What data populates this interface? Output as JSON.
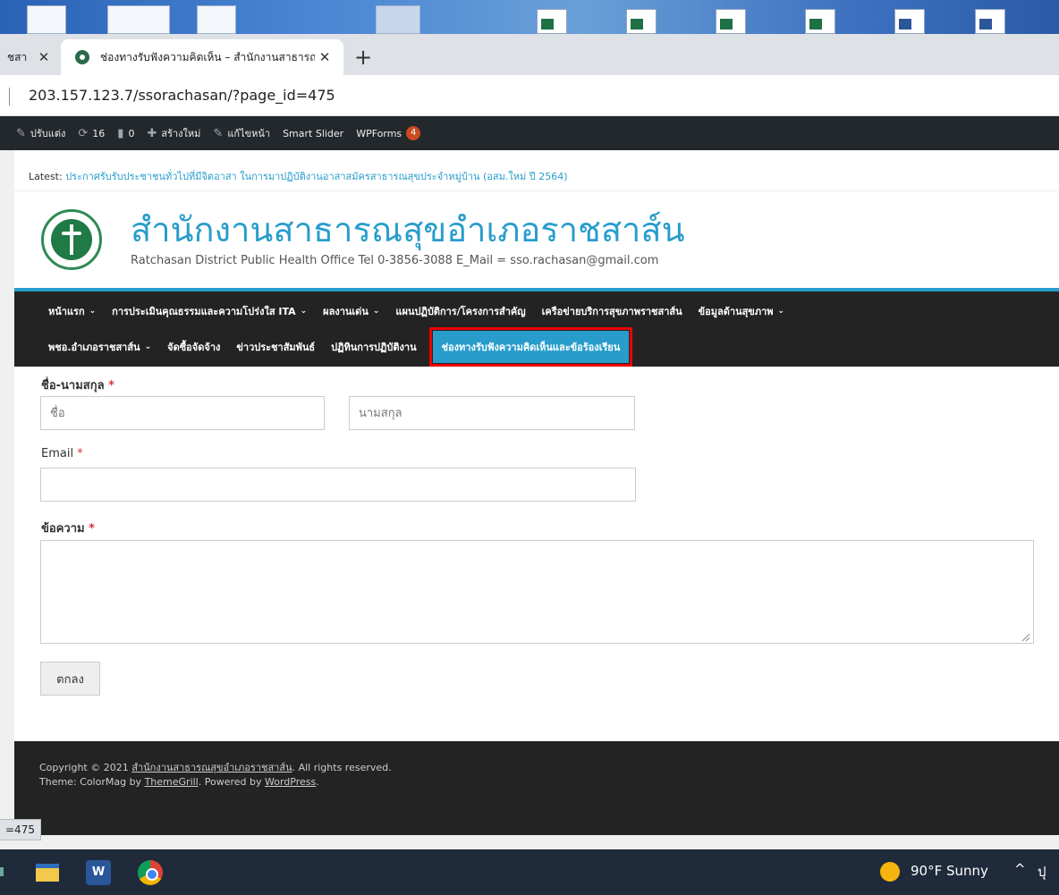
{
  "browser": {
    "tabs": [
      {
        "label": "ชสา"
      },
      {
        "label": "ช่องทางรับฟังความคิดเห็น – สำนักงานสาธารณสุขอำเภอราชสาส์น"
      }
    ],
    "close_glyph": "✕",
    "new_tab_glyph": "+",
    "url": "203.157.123.7/ssorachasan/?page_id=475",
    "status_url": "=475"
  },
  "adminbar": {
    "customize": "ปรับแต่ง",
    "updates_count": "16",
    "comments_count": "0",
    "new": "สร้างใหม่",
    "edit_page": "แก้ไขหน้า",
    "smart_slider": "Smart Slider",
    "wpforms": "WPForms",
    "wpforms_badge": "4"
  },
  "site": {
    "latest_label": "Latest:",
    "latest_link": "ประกาศรับรับประชาชนทั่วไปที่มีจิตอาสา ในการมาปฏิบัติงานอาสาสมัครสาธารณสุขประจำหมู่บ้าน (อสม.ใหม่ ปี 2564)",
    "title": "สำนักงานสาธารณสุขอำเภอราชสาส์น",
    "description": "Ratchasan District Public Health Office Tel 0-3856-3088 E_Mail = sso.rachasan@gmail.com"
  },
  "nav": {
    "row1": [
      {
        "label": "หน้าแรก",
        "dropdown": true
      },
      {
        "label": "การประเมินคุณธรรมและความโปร่งใส ITA",
        "dropdown": true
      },
      {
        "label": "ผลงานเด่น",
        "dropdown": true
      },
      {
        "label": "แผนปฏิบัติการ/โครงการสำคัญ",
        "dropdown": false
      },
      {
        "label": "เครือข่ายบริการสุขภาพราชสาส์น",
        "dropdown": false
      },
      {
        "label": "ข้อมูลด้านสุขภาพ",
        "dropdown": true
      }
    ],
    "row2": [
      {
        "label": "พชอ.อำเภอราชสาส์น",
        "dropdown": true
      },
      {
        "label": "จัดซื้อจัดจ้าง",
        "dropdown": false
      },
      {
        "label": "ข่าวประชาสัมพันธ์",
        "dropdown": false
      },
      {
        "label": "ปฏิทินการปฏิบัติงาน",
        "dropdown": false
      },
      {
        "label": "ช่องทางรับฟังความคิดเห็นและข้อร้องเรียน",
        "dropdown": false,
        "active": true
      }
    ],
    "chevron": "⌄"
  },
  "form": {
    "name_label": "ชื่อ-นามสกุล",
    "required_mark": "*",
    "first_placeholder": "ชื่อ",
    "last_placeholder": "นามสกุล",
    "email_label": "Email",
    "message_label": "ข้อความ",
    "submit_label": "ตกลง"
  },
  "footer": {
    "copyright_prefix": "Copyright © 2021",
    "site_link": "สำนักงานสาธารณสุขอำเภอราชสาส์น",
    "copyright_suffix": ". All rights reserved.",
    "theme_prefix": "Theme: ColorMag by",
    "theme_author": "ThemeGrill",
    "powered_prefix": ". Powered by",
    "powered_link": "WordPress",
    "powered_suffix": "."
  },
  "taskbar": {
    "word_glyph": "W",
    "weather": "90°F  Sunny",
    "tray_chevron": "^",
    "tray_cut": "ปุ"
  },
  "colors": {
    "accent": "#289dcc",
    "nav_bg": "#232323",
    "admin_bar": "#23282d",
    "highlight_box": "#ee0000"
  }
}
